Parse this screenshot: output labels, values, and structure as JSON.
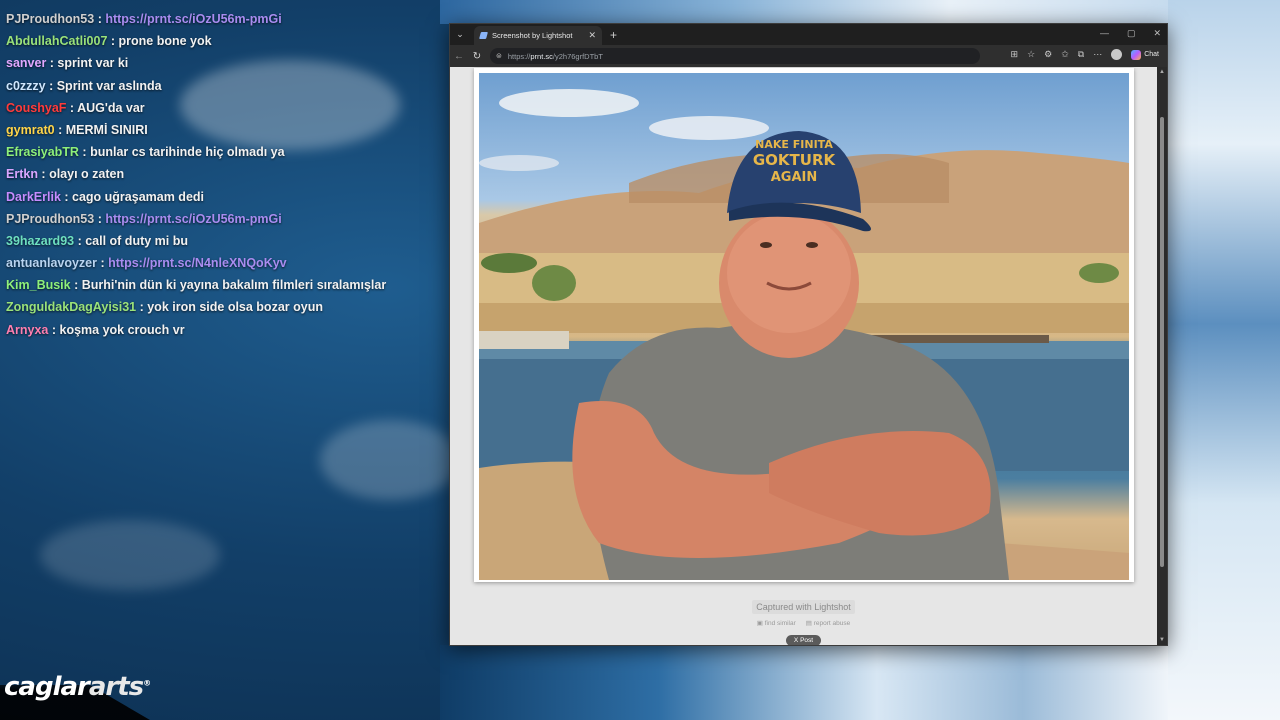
{
  "chat": {
    "messages": [
      {
        "user": "",
        "user_color": "#9e7be8",
        "text": "",
        "is_link": false
      },
      {
        "user": "PJProudhon53",
        "user_color": "#d0d0d0",
        "text": "https://prnt.sc/iOzU56m-pmGi",
        "is_link": true
      },
      {
        "user": "AbdullahCatli007",
        "user_color": "#9ae27a",
        "text": "prone bone yok",
        "is_link": false
      },
      {
        "user": "sanver",
        "user_color": "#e2a7ff",
        "text": "sprint var ki",
        "is_link": false
      },
      {
        "user": "c0zzzy",
        "user_color": "#cfe7ff",
        "text": "Sprint var aslında",
        "is_link": false
      },
      {
        "user": "CoushyaF",
        "user_color": "#ff3b3b",
        "text": "AUG'da var",
        "is_link": false
      },
      {
        "user": "gymrat0",
        "user_color": "#ffd54a",
        "text": "MERMİ SINIRI",
        "is_link": false
      },
      {
        "user": "EfrasiyabTR",
        "user_color": "#8ef07a",
        "text": "bunlar cs tarihinde hiç olmadı ya",
        "is_link": false
      },
      {
        "user": "Ertkn",
        "user_color": "#d9a6ff",
        "text": "olayı o zaten",
        "is_link": false
      },
      {
        "user": "DarkErlik",
        "user_color": "#c58cff",
        "text": "cago uğraşamam dedi",
        "is_link": false
      },
      {
        "user": "PJProudhon53",
        "user_color": "#d0d0d0",
        "text": "https://prnt.sc/iOzU56m-pmGi",
        "is_link": true
      },
      {
        "user": "39hazard93",
        "user_color": "#6ee0c0",
        "text": "call of duty mi bu",
        "is_link": false
      },
      {
        "user": "antuanlavoyzer",
        "user_color": "#b9d4f0",
        "text": "https://prnt.sc/N4nleXNQoKyv",
        "is_link": true
      },
      {
        "user": "Kim_Busik",
        "user_color": "#8ef07a",
        "text": "Burhi'nin dün ki yayına bakalım filmleri sıralamışlar",
        "is_link": false
      },
      {
        "user": "ZonguldakDagAyisi31",
        "user_color": "#9ae27a",
        "text": "yok iron side olsa bozar oyun",
        "is_link": false
      },
      {
        "user": "Arnyxa",
        "user_color": "#ff7fb0",
        "text": "koşma yok crouch vr",
        "is_link": false
      }
    ]
  },
  "browser": {
    "tab_title": "Screenshot by Lightshot",
    "url_host": "prnt.sc",
    "url_scheme": "https://",
    "url_path": "/y2h76grfDTbT",
    "chat_button_label": "Chat",
    "cap_text": "NAKE FINITA GOKTURK AGAIN"
  },
  "lightshot": {
    "captured_label": "Captured with Lightshot",
    "find_similar": "find similar",
    "report_abuse": "report abuse",
    "post_label": "X Post"
  },
  "branding": {
    "logo_main": "caglar",
    "logo_accent": "arts",
    "logo_mark": "®"
  },
  "colors": {
    "link": "#a98cf0",
    "browser_dark": "#202124"
  }
}
